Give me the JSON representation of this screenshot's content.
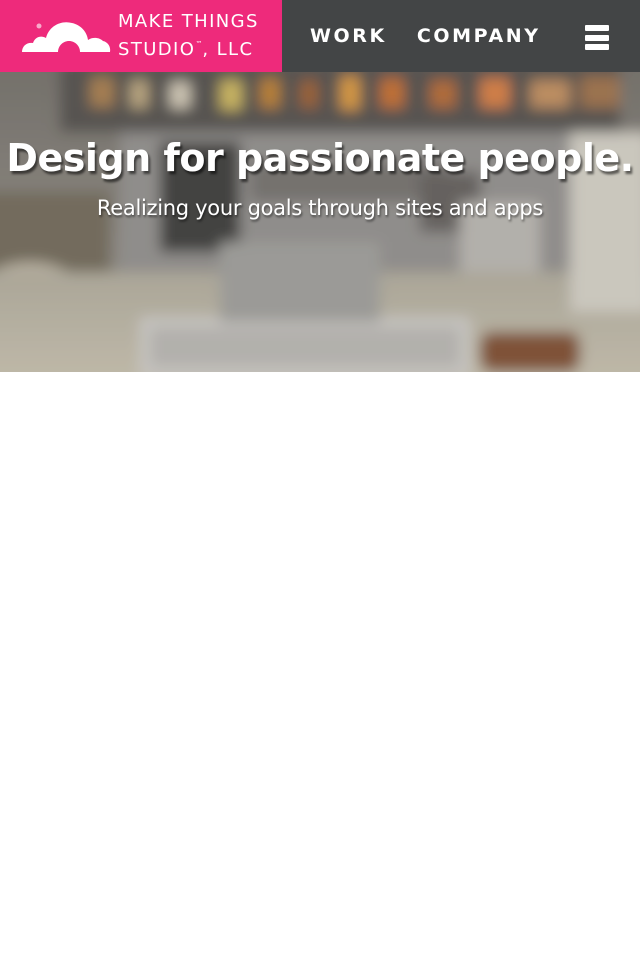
{
  "brand": {
    "name_line1": "MAKE THINGS",
    "name_line2": "STUDIO",
    "trademark": "™",
    "suffix": ", LLC",
    "logo_icon": "cloud-icon",
    "color": "#ee2a7b"
  },
  "nav": {
    "items": [
      {
        "label": "WORK"
      },
      {
        "label": "COMPANY"
      }
    ],
    "menu_icon": "hamburger-menu-icon",
    "background": "#434546"
  },
  "hero": {
    "title": "Design for passionate people.",
    "subtitle": "Realizing your goals through sites and apps"
  }
}
